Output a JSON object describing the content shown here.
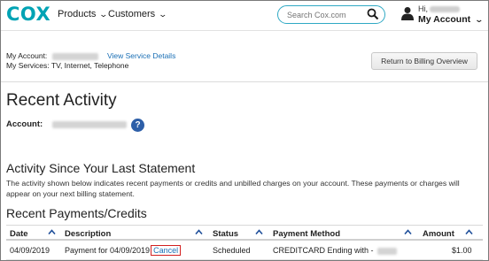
{
  "header": {
    "logo": "COX",
    "nav": [
      {
        "label": "Products"
      },
      {
        "label": "Customers"
      }
    ],
    "search": {
      "placeholder": "Search Cox.com",
      "value": ""
    },
    "account": {
      "greeting": "Hi,",
      "menu_label": "My Account"
    }
  },
  "account_bar": {
    "my_account_label": "My Account:",
    "view_service_details": "View Service Details",
    "my_services_label": "My Services:",
    "my_services_value": "TV, Internet, Telephone",
    "return_button": "Return to Billing Overview"
  },
  "recent_activity": {
    "title": "Recent Activity",
    "account_label": "Account:",
    "help_icon": "?"
  },
  "since_statement": {
    "title": "Activity Since Your Last Statement",
    "description": "The activity shown below indicates recent payments or credits and unbilled charges on your account. These payments or charges will appear on your next billing statement."
  },
  "payments": {
    "title": "Recent Payments/Credits",
    "columns": [
      "Date",
      "Description",
      "Status",
      "Payment Method",
      "Amount"
    ],
    "rows": [
      {
        "date": "04/09/2019",
        "description": "Payment for 04/09/2019",
        "action": "Cancel",
        "status": "Scheduled",
        "method": "CREDITCARD Ending with -",
        "amount": "$1.00"
      }
    ]
  },
  "colors": {
    "brand": "#00a3b4",
    "link": "#1a6fb5",
    "help": "#2d5fa8",
    "highlight_box": "#d21f1f"
  }
}
